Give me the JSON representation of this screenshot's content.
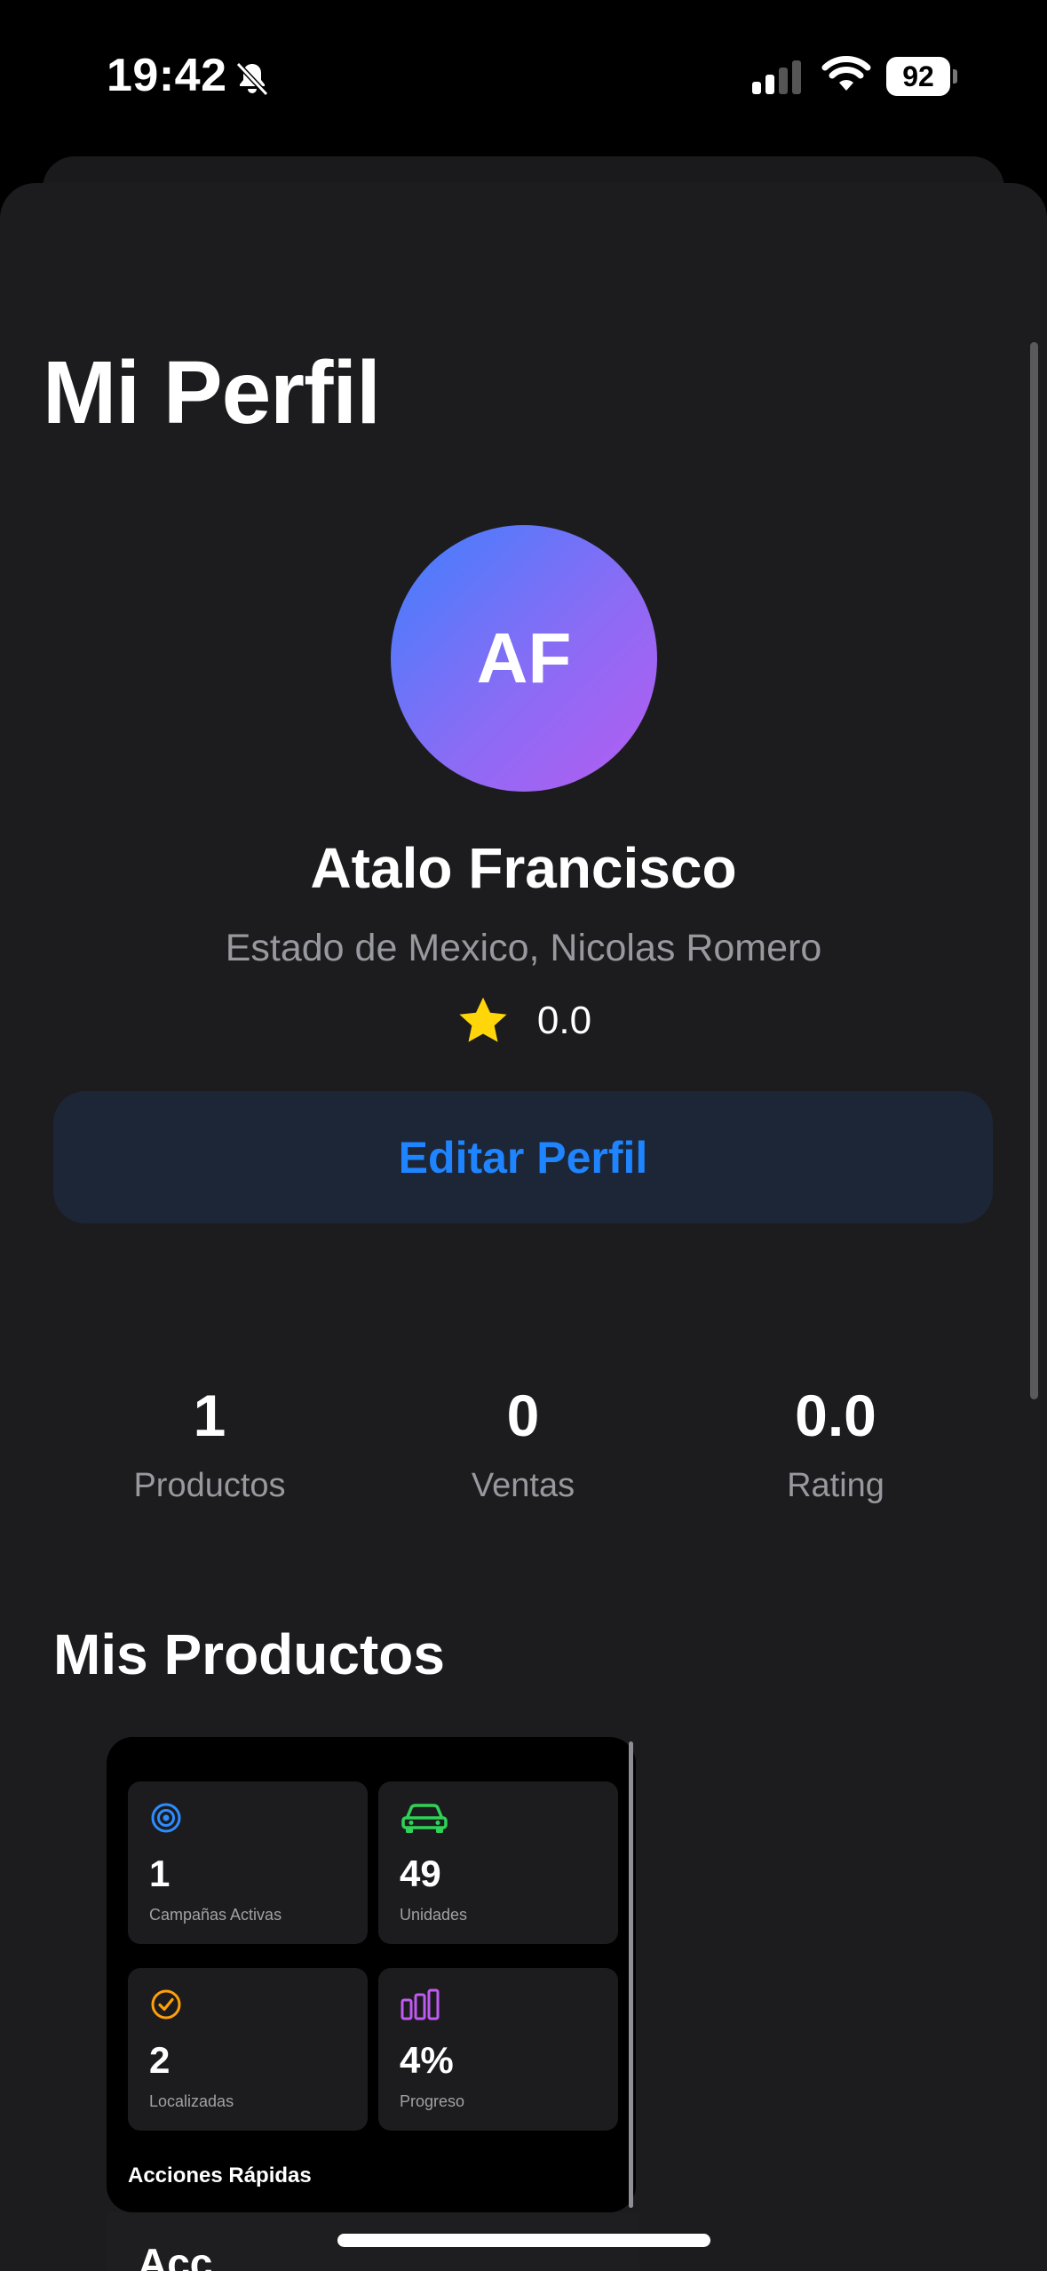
{
  "status_bar": {
    "time": "19:42",
    "battery": "92"
  },
  "page": {
    "title": "Mi Perfil"
  },
  "profile": {
    "initials": "AF",
    "name": "Atalo Francisco",
    "location": "Estado de Mexico, Nicolas Romero",
    "rating": "0.0",
    "edit_label": "Editar Perfil"
  },
  "stats": [
    {
      "value": "1",
      "label": "Productos"
    },
    {
      "value": "0",
      "label": "Ventas"
    },
    {
      "value": "0.0",
      "label": "Rating"
    }
  ],
  "products_section": {
    "title": "Mis Productos",
    "preview": {
      "metrics": [
        {
          "icon": "target-icon",
          "value": "1",
          "label": "Campañas Activas",
          "color": "#2d8cff"
        },
        {
          "icon": "car-icon",
          "value": "49",
          "label": "Unidades",
          "color": "#30d158"
        },
        {
          "icon": "checkmark-circle-icon",
          "value": "2",
          "label": "Localizadas",
          "color": "#ff9f0a"
        },
        {
          "icon": "bar-chart-icon",
          "value": "4%",
          "label": "Progreso",
          "color": "#bf5af2"
        }
      ],
      "quick_actions": "Acciones Rápidas"
    },
    "partial_text": "Acc"
  },
  "colors": {
    "accent": "#1f84ff",
    "star": "#ffd60a",
    "background": "#1c1c1e"
  }
}
